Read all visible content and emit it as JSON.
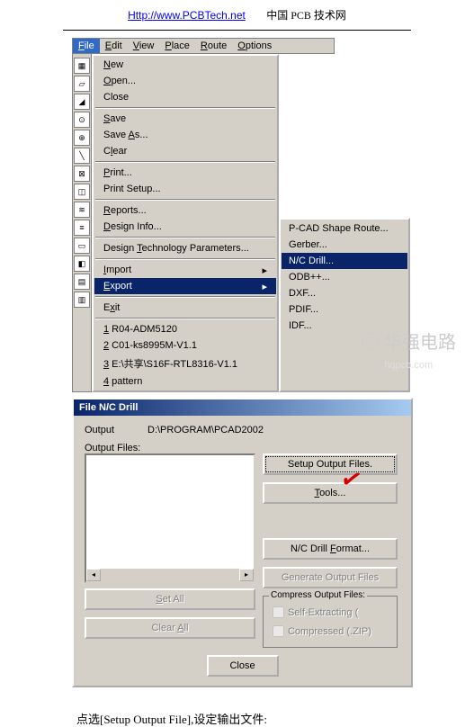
{
  "header": {
    "url": "Http://www.PCBTech.net",
    "text": "中国 PCB 技术网"
  },
  "menubar": [
    "File",
    "Edit",
    "View",
    "Place",
    "Route",
    "Options"
  ],
  "menu1": [
    {
      "t": "New",
      "u": 0
    },
    {
      "t": "Open...",
      "u": 0
    },
    {
      "t": "Close"
    },
    "sep",
    {
      "t": "Save",
      "u": 0
    },
    {
      "t": "Save As...",
      "u": 5
    },
    {
      "t": "Clear",
      "u": 1
    },
    "sep",
    {
      "t": "Print...",
      "u": 0
    },
    {
      "t": "Print Setup..."
    },
    "sep",
    {
      "t": "Reports...",
      "u": 0
    },
    {
      "t": "Design Info...",
      "u": 0
    },
    "sep",
    {
      "t": "Design Technology Parameters...",
      "u": 7
    },
    "sep",
    {
      "t": "Import",
      "u": 0,
      "arrow": true
    },
    {
      "t": "Export",
      "u": 0,
      "arrow": true,
      "sel": true
    },
    "sep",
    {
      "t": "Exit",
      "u": 1
    },
    "sep",
    {
      "t": "1 R04-ADM5120",
      "u": 0
    },
    {
      "t": "2 C01-ks8995M-V1.1",
      "u": 0
    },
    {
      "t": "3 E:\\共享\\S16F-RTL8316-V1.1",
      "u": 0
    },
    {
      "t": "4 pattern",
      "u": 0
    }
  ],
  "menu2": [
    {
      "t": "P-CAD Shape Route..."
    },
    {
      "t": "Gerber...",
      "u": 0
    },
    {
      "t": "N/C Drill...",
      "u": 0,
      "sel": true
    },
    {
      "t": "ODB++...",
      "u": 0
    },
    {
      "t": "DXF...",
      "u": 1
    },
    {
      "t": "PDIF...",
      "u": 0
    },
    {
      "t": "IDF...",
      "u": 2
    }
  ],
  "dialog": {
    "title": "File N/C Drill",
    "output_lbl": "Output",
    "output_val": "D:\\PROGRAM\\PCAD2002",
    "files_lbl": "Output Files:",
    "btn_setup": "Setup Output Files.",
    "btn_tools": "Tools...",
    "btn_fmt": "N/C Drill Format...",
    "btn_gen": "Generate Output Files",
    "legend": "Compress Output Files:",
    "cb1": "Self-Extracting (",
    "cb2": "Compressed (.ZIP)",
    "btn_setall": "Set All",
    "btn_clearall": "Clear All",
    "btn_close": "Close"
  },
  "watermark": {
    "l1": "华强电路",
    "l2": "hqpcb.com"
  },
  "footer": "点选[Setup Output File],设定输出文件:"
}
